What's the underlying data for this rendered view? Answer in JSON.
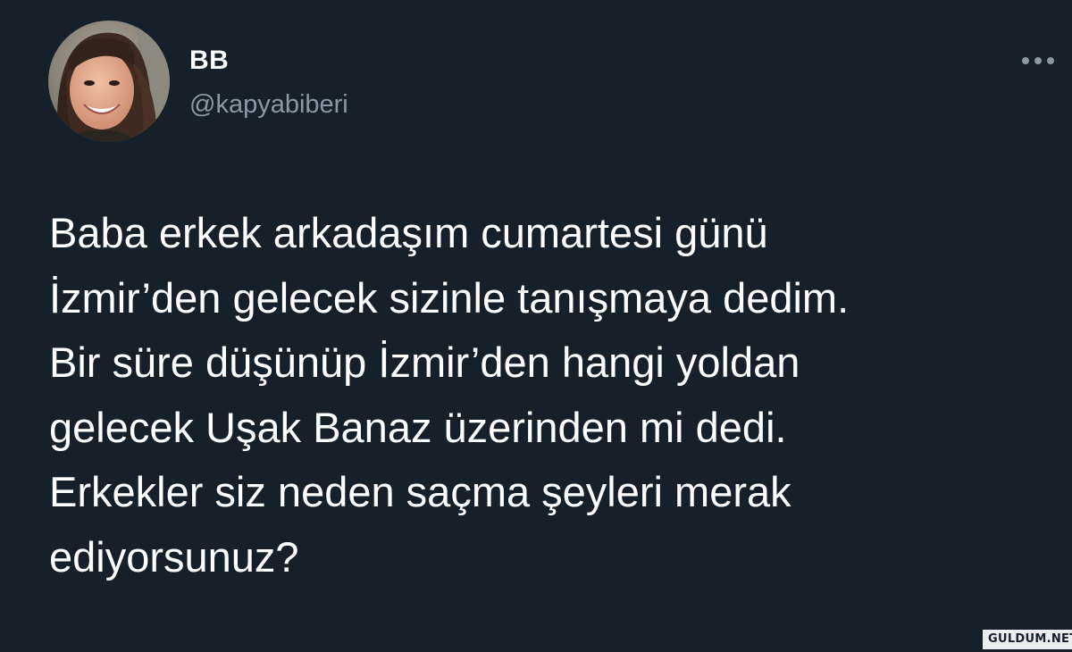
{
  "tweet": {
    "author": {
      "display_name": "BB",
      "handle": "@kapyabiberi",
      "avatar_icon": "profile-photo"
    },
    "more_icon": "more-options-icon",
    "text_lines": [
      "Baba erkek arkadaşım cumartesi günü",
      "İzmir’den gelecek sizinle tanışmaya dedim.",
      "Bir süre düşünüp İzmir’den hangi yoldan",
      "gelecek Uşak Banaz üzerinden mi dedi.",
      "Erkekler siz neden saçma şeyleri merak",
      "ediyorsunuz?"
    ]
  },
  "watermark": {
    "text": "GULDUM.NET"
  },
  "colors": {
    "background": "#15202b",
    "primary_text": "#ffffff",
    "secondary_text": "#8b98a5"
  }
}
